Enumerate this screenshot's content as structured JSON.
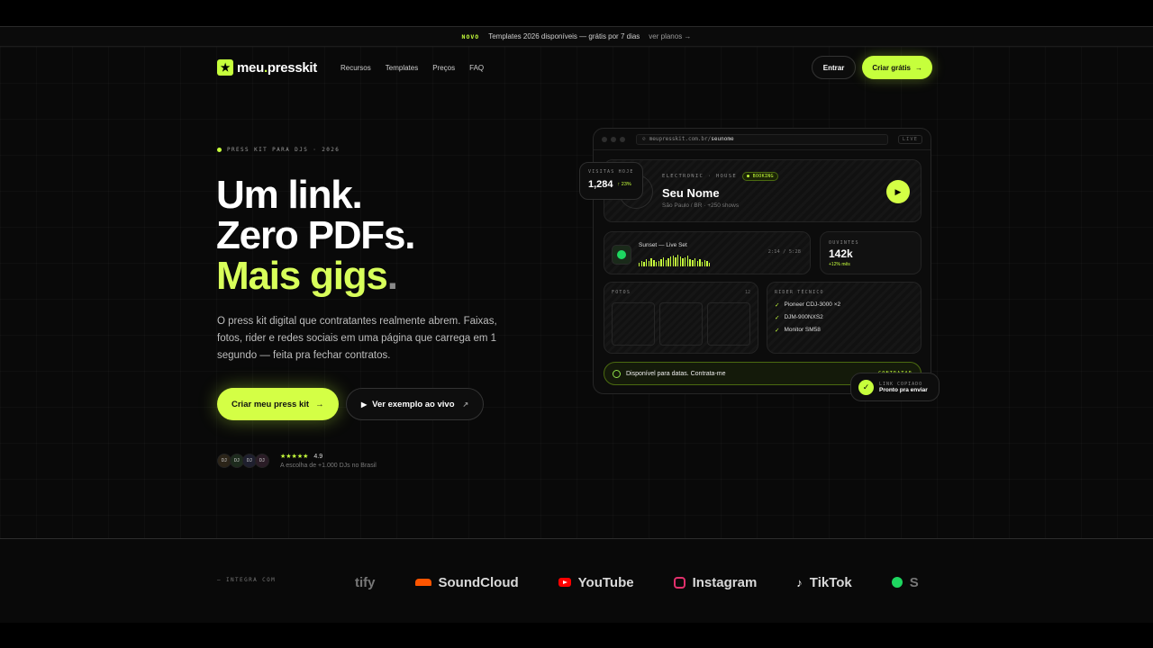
{
  "banner": {
    "tag": "NOVO",
    "text": "Templates 2026 disponíveis — grátis por 7 dias",
    "link": "ver planos →"
  },
  "nav": {
    "logo_prefix": "meu",
    "logo_dot": ".",
    "logo_suffix": "presskit",
    "links": [
      "Recursos",
      "Templates",
      "Preços",
      "FAQ"
    ],
    "login": "Entrar",
    "signup": "Criar grátis",
    "signup_arrow": "→"
  },
  "hero": {
    "eyebrow": "PRESS KIT PARA DJS · 2026",
    "line1": "Um link.",
    "line2": "Zero PDFs.",
    "line3": "Mais gigs",
    "line3_dot": ".",
    "lead": "O press kit digital que contratantes realmente abrem. Faixas, fotos, rider e redes sociais em uma página que carrega em 1 segundo — feita pra fechar contratos.",
    "cta_primary": "Criar meu press kit",
    "cta_primary_arrow": "→",
    "cta_secondary": "Ver exemplo ao vivo",
    "cta_secondary_arrow": "↗",
    "avatars": [
      "DJ",
      "DJ",
      "DJ",
      "DJ"
    ],
    "stars": "★★★★★",
    "rating": "4.9",
    "caption": "A escolha de +1.000 DJs no Brasil"
  },
  "mock": {
    "url_prefix": "meupresskit.com.br/",
    "url_slug": "seunome",
    "live": "LIVE",
    "visits_label": "VISITAS HOJE",
    "visits_value": "1,284",
    "visits_delta": "↑ 23%",
    "genre": "ELECTRONIC · HOUSE",
    "badge": "● BOOKING",
    "name": "Seu Nome",
    "location": "São Paulo / BR · +250 shows",
    "track_title": "Sunset — Live Set",
    "track_time": "2:14 / 5:28",
    "listeners_label": "OUVINTES",
    "listeners_value": "142k",
    "listeners_delta": "+12% mês",
    "photos_label": "FOTOS",
    "photos_count": "12",
    "rider_label": "RIDER TÉCNICO",
    "rider_items": [
      "Pioneer CDJ-3000 ×2",
      "DJM-900NXS2",
      "Monitor SM58"
    ],
    "contract_text": "Disponível para datas. Contrata-me",
    "contract_action": "CONTRATAR",
    "toast_label": "LINK COPIADO",
    "toast_text": "Pronto pra enviar"
  },
  "integrations": {
    "label": "— INTEGRA COM",
    "brands": [
      "tify",
      "SoundCloud",
      "YouTube",
      "Instagram",
      "TikTok",
      "S"
    ]
  },
  "colors": {
    "accent": "#c6ff3c",
    "background": "#090909"
  }
}
